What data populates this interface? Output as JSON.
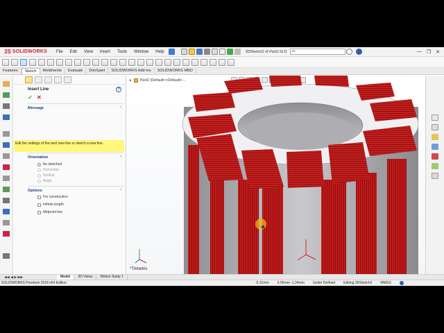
{
  "app": {
    "brand": "SOLIDWORKS",
    "brand_mark": "3S",
    "document_title": "3DSketch2 of Part2.SLD...",
    "search_value": "ss"
  },
  "menus": [
    "File",
    "Edit",
    "View",
    "Insert",
    "Tools",
    "Window",
    "Help"
  ],
  "tabs": [
    "Features",
    "Sketch",
    "Weldments",
    "Evaluate",
    "DimXpert",
    "SOLIDWORKS Add-Ins",
    "SOLIDWORKS MBD"
  ],
  "active_tab": "Sketch",
  "property_manager": {
    "title": "Insert Line",
    "help_label": "?",
    "ok_symbol": "✓",
    "cancel_symbol": "✕",
    "message": {
      "header": "Message",
      "text": "Edit the settings of the next new line or sketch a new line."
    },
    "orientation": {
      "header": "Orientation",
      "options": [
        {
          "label": "As sketched",
          "selected": true,
          "enabled": true
        },
        {
          "label": "Horizontal",
          "selected": false,
          "enabled": false
        },
        {
          "label": "Vertical",
          "selected": false,
          "enabled": false
        },
        {
          "label": "Angle",
          "selected": false,
          "enabled": false
        }
      ]
    },
    "options": {
      "header": "Options",
      "items": [
        {
          "label": "For construction",
          "checked": false
        },
        {
          "label": "Infinite length",
          "checked": false
        },
        {
          "label": "Midpoint line",
          "checked": false
        }
      ]
    }
  },
  "viewport": {
    "tree_item": "Part2 (Default<<Default>...",
    "view_name": "*Trimetric"
  },
  "model_tabs": [
    "Model",
    "3D Views",
    "Motion Study 1"
  ],
  "active_model_tab": "Model",
  "status": {
    "app_edition": "SOLIDWORKS Premium 2018 x64 Edition",
    "x": "-5.31mm",
    "y_z": "5.95mm  -1.24mm",
    "state": "Under Defined",
    "editing": "Editing 3DSketch2",
    "units": "MMGS"
  },
  "colors": {
    "brand_red": "#d71920",
    "coil_red": "#c41a1a",
    "stator_gray": "#a9a9ad",
    "message_yellow": "#fff77a"
  }
}
